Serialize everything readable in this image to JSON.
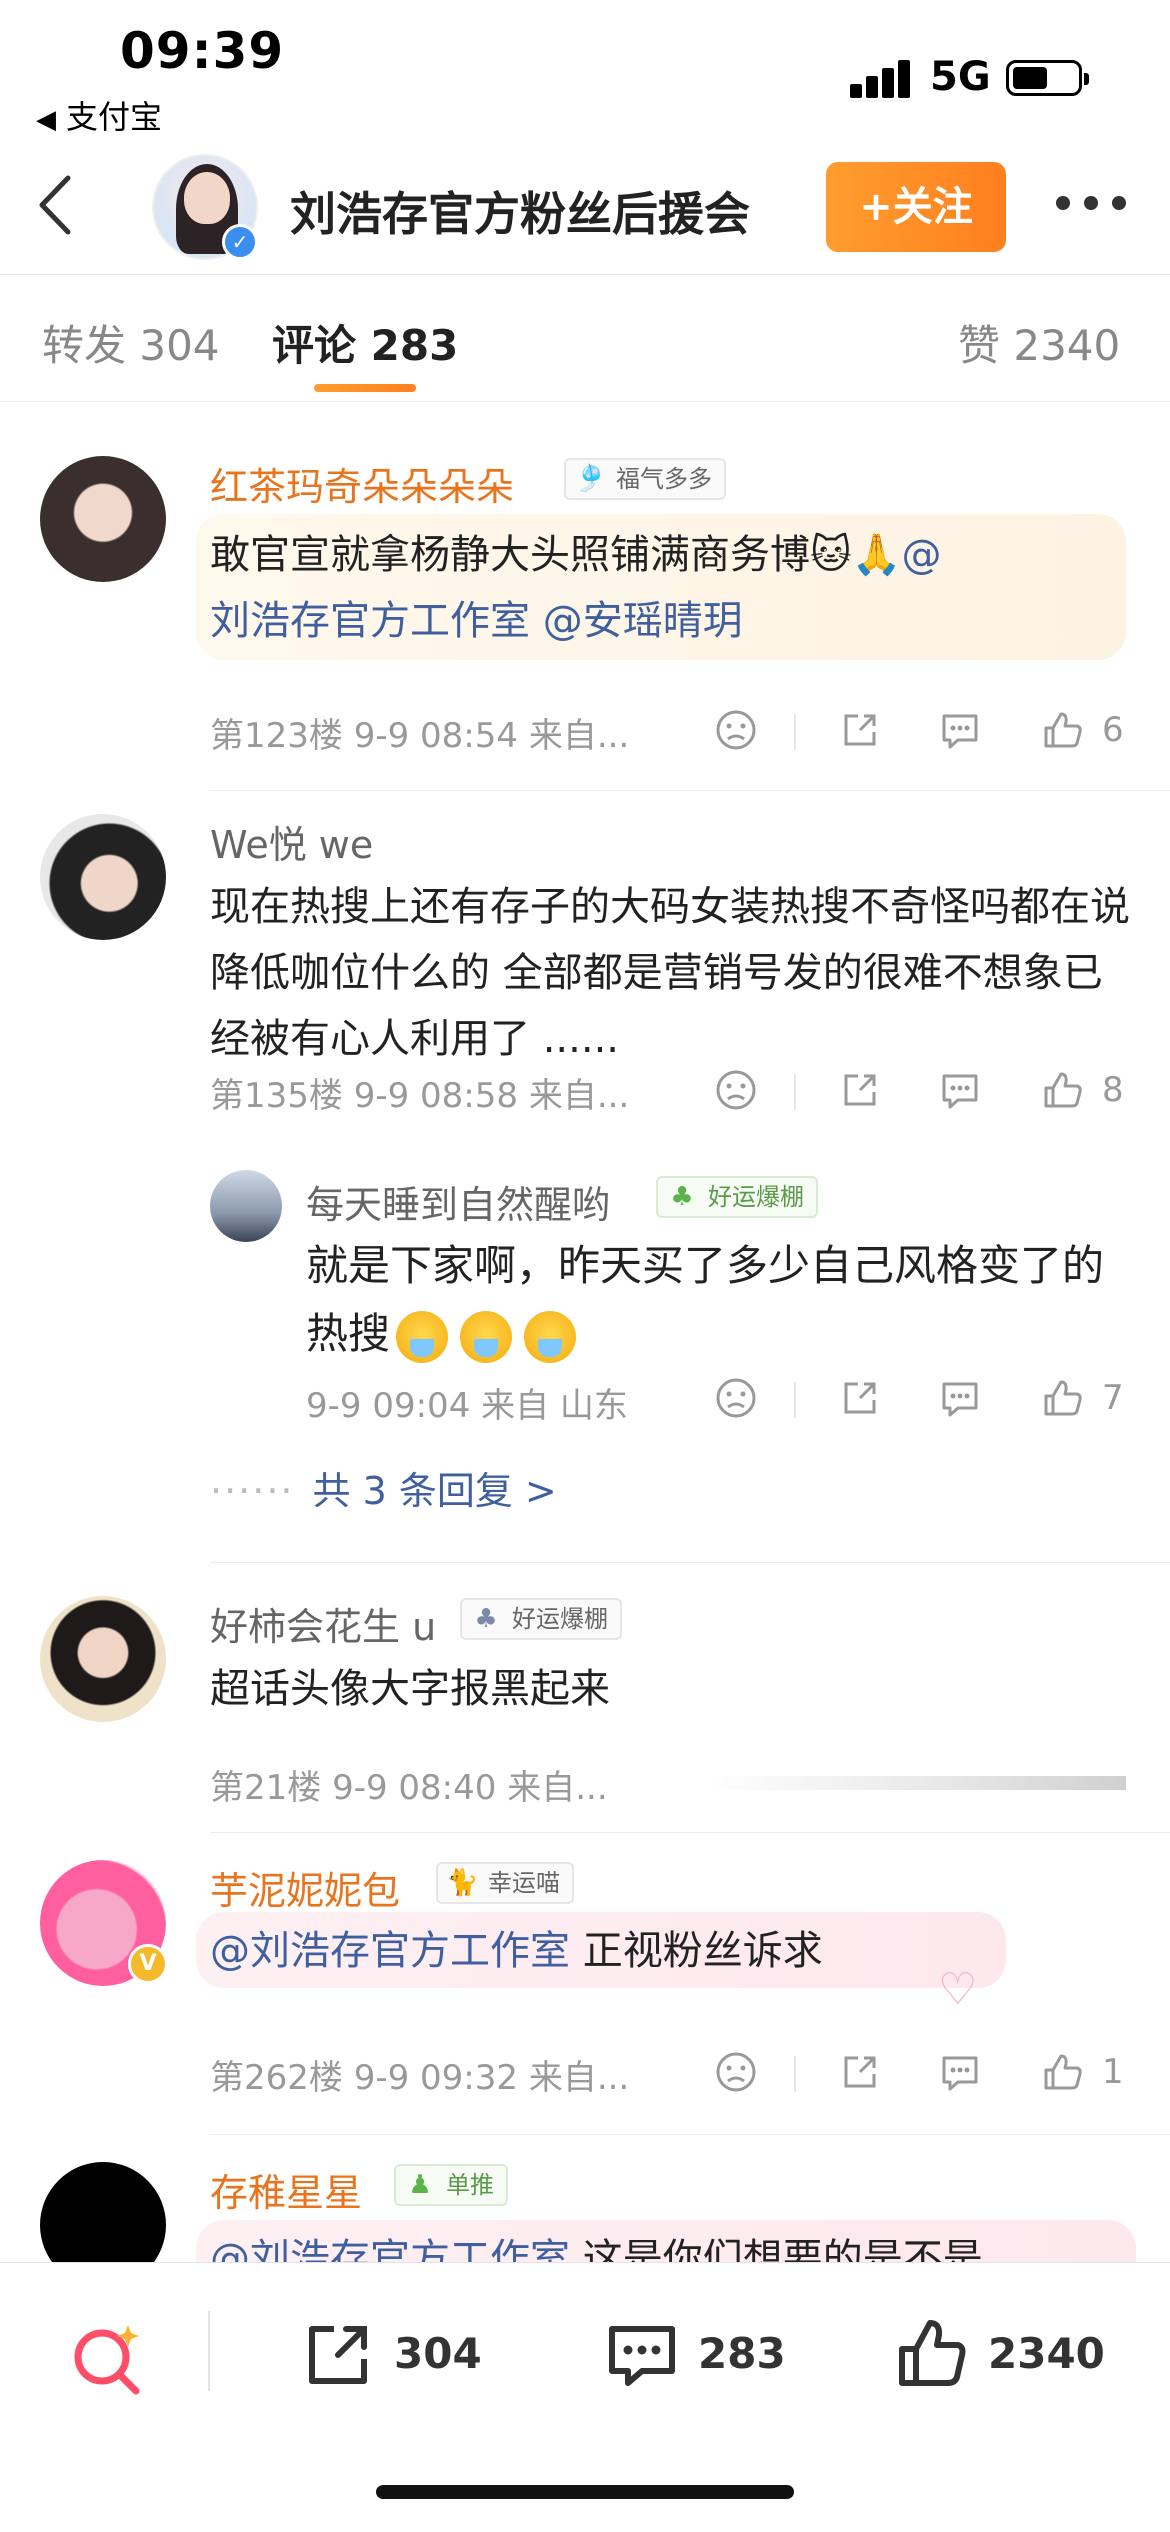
{
  "status_bar": {
    "time": "09:39",
    "back_app": "支付宝",
    "network": "5G",
    "battery_level": 0.55
  },
  "header": {
    "title": "刘浩存官方粉丝后援会",
    "follow_label": "+关注"
  },
  "tabs": {
    "repost": "转发 304",
    "comment": "评论 283",
    "like": "赞 2340"
  },
  "comments": [
    {
      "username": "红茶玛奇朵朵朵朵",
      "username_color": "#e8741e",
      "badge": "福气多多",
      "text_main": "敢官宣就拿杨静大头照铺满商务博",
      "text_tail": "@",
      "line2_mention1": "刘浩存官方工作室",
      "line2_mention2": "@安瑶晴玥",
      "meta": "第123楼  9-9 08:54  来自...",
      "likes": "6"
    },
    {
      "username": "We悦 we",
      "username_color": "#666666",
      "text": "现在热搜上还有存子的大码女装热搜不奇怪吗都在说降低咖位什么的 全部都是营销号发的很难不想象已经被有心人利用了 ......",
      "meta": "第135楼  9-9 08:58  来自...",
      "likes": "8",
      "reply": {
        "username": "每天睡到自然醒哟",
        "badge": "好运爆棚",
        "text": "就是下家啊，昨天买了多少自己风格变了的热搜",
        "meta": "9-9 09:04  来自 山东",
        "likes": "7"
      },
      "more_replies": "共 3 条回复 >"
    },
    {
      "username": "好柿会花生 u",
      "username_color": "#666666",
      "badge": "好运爆棚",
      "text": "超话头像大字报黑起来",
      "meta": "第21楼  9-9 08:40  来自..."
    },
    {
      "username": "芋泥妮妮包",
      "username_color": "#e8741e",
      "badge": "幸运喵",
      "mention": "@刘浩存官方工作室",
      "text": "正视粉丝诉求",
      "meta": "第262楼  9-9 09:32  来自...",
      "likes": "1"
    },
    {
      "username": "存稚星星",
      "username_color": "#e8741e",
      "badge": "单推",
      "mention": "@刘浩存官方工作室",
      "text": "这是你们想要的是不是"
    }
  ],
  "bottom_bar": {
    "repost_count": "304",
    "comment_count": "283",
    "like_count": "2340"
  },
  "colors": {
    "accent_orange": "#ff8a24",
    "mention_blue": "#3f5f9e",
    "verify_blue": "#3a8ef0",
    "vip_gold": "#f5b92c"
  }
}
